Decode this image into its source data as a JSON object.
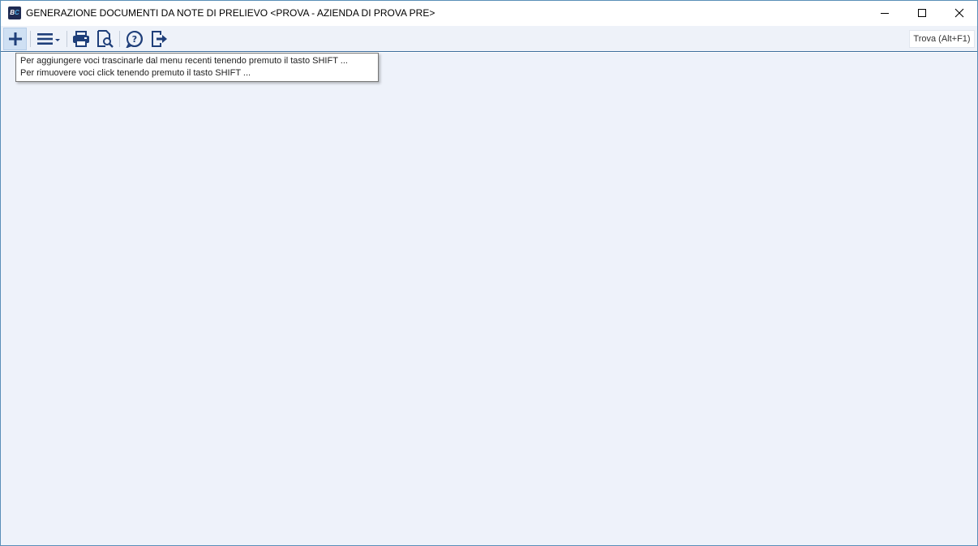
{
  "window": {
    "title": "GENERAZIONE DOCUMENTI DA NOTE DI PRELIEVO <PROVA - AZIENDA DI PROVA PRE>",
    "app_icon_letters": {
      "b": "B",
      "c": "C"
    },
    "controls": {
      "minimize": "minimize-icon",
      "maximize": "maximize-icon",
      "close": "close-icon"
    }
  },
  "toolbar": {
    "buttons": [
      {
        "icon": "plus-icon"
      },
      {
        "icon": "hamburger-menu-icon"
      },
      {
        "icon": "printer-icon"
      },
      {
        "icon": "print-preview-icon"
      },
      {
        "icon": "help-icon"
      },
      {
        "icon": "exit-icon"
      }
    ],
    "find_label": "Trova (Alt+F1)"
  },
  "tooltip": {
    "line1": "Per aggiungere voci trascinarle dal menu recenti tenendo premuto il tasto SHIFT ...",
    "line2": "Per rimuovere voci click tenendo premuto il tasto SHIFT ..."
  },
  "colors": {
    "accent": "#1f3f7a",
    "toolbar_bg": "#eef2f9",
    "content_bg": "#eef2fa",
    "border": "#3e6e9c"
  }
}
